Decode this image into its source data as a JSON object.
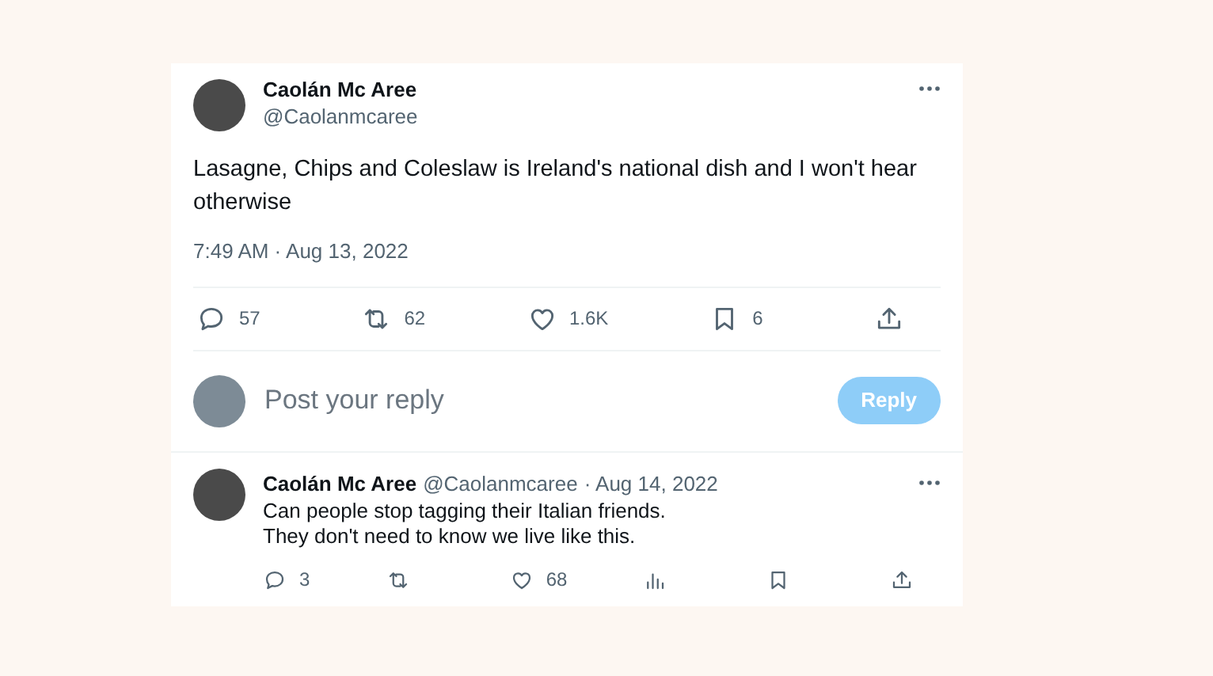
{
  "tweet": {
    "name": "Caolán Mc Aree",
    "handle": "@Caolanmcaree",
    "text": "Lasagne, Chips and Coleslaw is Ireland's national dish and I won't hear otherwise",
    "timestamp": "7:49 AM · Aug 13, 2022",
    "actions": [
      {
        "kind": "reply",
        "count": "57"
      },
      {
        "kind": "repost",
        "count": "62"
      },
      {
        "kind": "like",
        "count": "1.6K"
      },
      {
        "kind": "bookmark",
        "count": "6"
      },
      {
        "kind": "share"
      }
    ]
  },
  "composer": {
    "placeholder": "Post your reply",
    "button": "Reply",
    "disabled": true
  },
  "reply": {
    "name": "Caolán Mc Aree",
    "handle": "@Caolanmcaree",
    "date": "· Aug 14, 2022",
    "lines": [
      "Can people stop tagging their Italian friends.",
      "They don't need to know we live like this."
    ],
    "actions": [
      {
        "kind": "reply",
        "count": "3"
      },
      {
        "kind": "repost"
      },
      {
        "kind": "like",
        "count": "68"
      },
      {
        "kind": "views"
      },
      {
        "kind": "bookmark"
      },
      {
        "kind": "share"
      }
    ]
  }
}
